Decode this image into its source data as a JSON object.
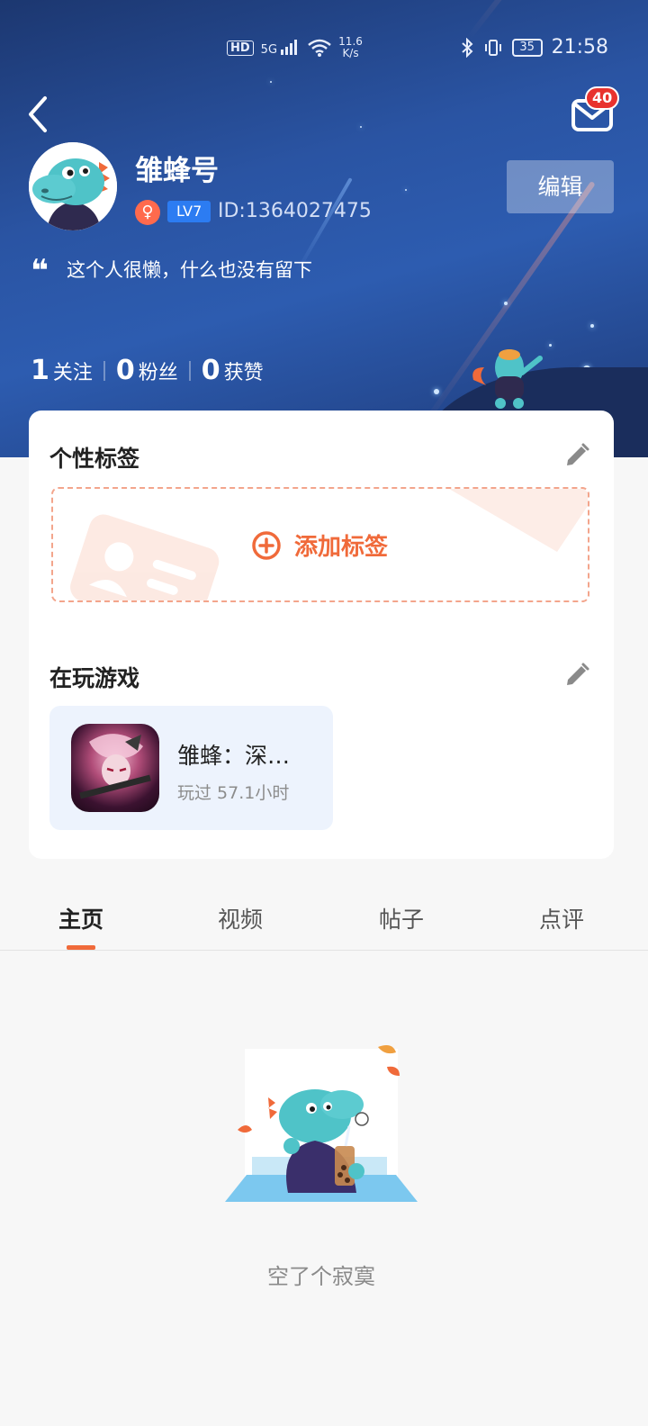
{
  "status_bar": {
    "hd": "HD",
    "net": "5G",
    "speed_value": "11.6",
    "speed_unit": "K/s",
    "battery": "35",
    "time": "21:58"
  },
  "header": {
    "mail_badge": "40"
  },
  "profile": {
    "username": "雏蜂号",
    "gender_symbol": "♀",
    "level": "LV7",
    "user_id": "ID:1364027475",
    "edit_label": "编辑",
    "quote_mark": "❝",
    "bio": "这个人很懒，什么也没有留下"
  },
  "stats": [
    {
      "num": "1",
      "label": "关注"
    },
    {
      "num": "0",
      "label": "粉丝"
    },
    {
      "num": "0",
      "label": "获赞"
    }
  ],
  "tags_section": {
    "title": "个性标签",
    "add_label": "添加标签"
  },
  "games_section": {
    "title": "在玩游戏",
    "game": {
      "name": "雏蜂：深…",
      "playtime": "玩过 57.1小时"
    }
  },
  "tabs": [
    {
      "label": "主页"
    },
    {
      "label": "视频"
    },
    {
      "label": "帖子"
    },
    {
      "label": "点评"
    }
  ],
  "empty_state": {
    "text": "空了个寂寞"
  },
  "colors": {
    "accent": "#f06a3a",
    "level_badge": "#2c7cf2",
    "badge_red": "#e8322e",
    "hero_blue": "#2a54a3"
  }
}
